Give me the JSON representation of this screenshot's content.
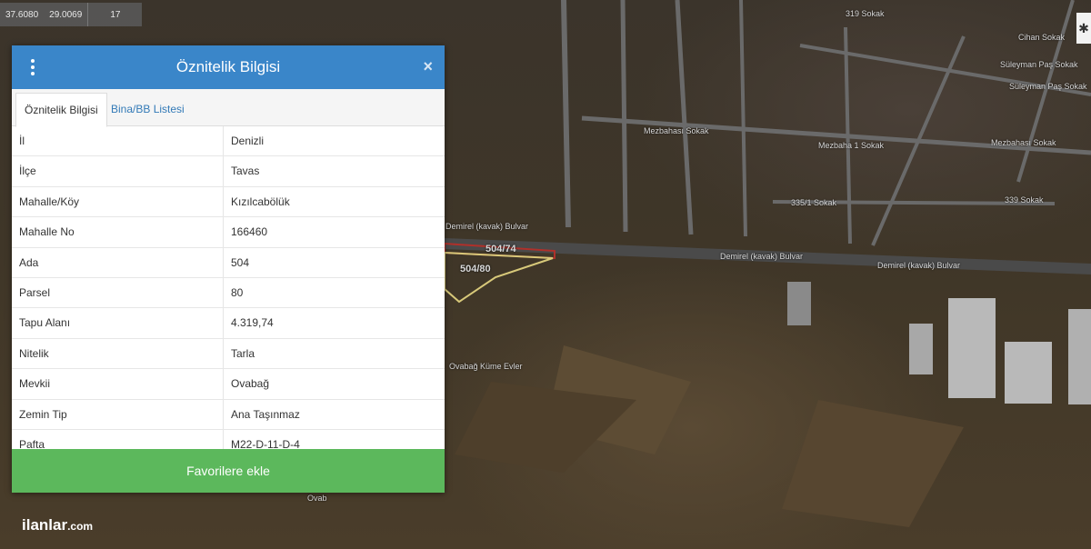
{
  "coords": {
    "lat": "37.6080",
    "lon": "29.0069",
    "zoom": "17"
  },
  "map_labels": {
    "parcel_a": "504/74",
    "parcel_b": "504/80",
    "road_1": "Demirel (kavak) Bulvar",
    "road_2": "Demirel (kavak) Bulvar",
    "road_3": "Demirel (kavak) Bulvar",
    "street_1": "Süleyman Paş Sokak",
    "street_2": "Süleyman Paş Sokak",
    "street_3": "Mezbahası Sokak",
    "street_4": "Mezbaha 1 Sokak",
    "street_5": "Mezbahası Sokak",
    "street_6": "335/1 Sokak",
    "street_7": "339 Sokak",
    "street_8": "319 Sokak",
    "street_9": "Cihan Sokak",
    "street_10": "Ovabağ Küme Evler",
    "street_11": "Ovab"
  },
  "panel": {
    "title": "Öznitelik Bilgisi",
    "tabs": [
      "Öznitelik Bilgisi",
      "Bina/BB Listesi"
    ],
    "rows": [
      {
        "key": "İl",
        "value": "Denizli"
      },
      {
        "key": "İlçe",
        "value": "Tavas"
      },
      {
        "key": "Mahalle/Köy",
        "value": "Kızılcabölük"
      },
      {
        "key": "Mahalle No",
        "value": "166460"
      },
      {
        "key": "Ada",
        "value": "504"
      },
      {
        "key": "Parsel",
        "value": "80"
      },
      {
        "key": "Tapu Alanı",
        "value": "4.319,74"
      },
      {
        "key": "Nitelik",
        "value": "Tarla"
      },
      {
        "key": "Mevkii",
        "value": "Ovabağ"
      },
      {
        "key": "Zemin Tip",
        "value": "Ana Taşınmaz"
      },
      {
        "key": "Pafta",
        "value": "M22-D-11-D-4"
      }
    ],
    "favorite_label": "Favorilere ekle",
    "close_glyph": "×"
  },
  "logo": {
    "text": "ilanlar",
    "suffix": ".com"
  },
  "colors": {
    "header": "#3a86c9",
    "favorite": "#5cb85c",
    "parcel_border": "#d8c97a"
  }
}
